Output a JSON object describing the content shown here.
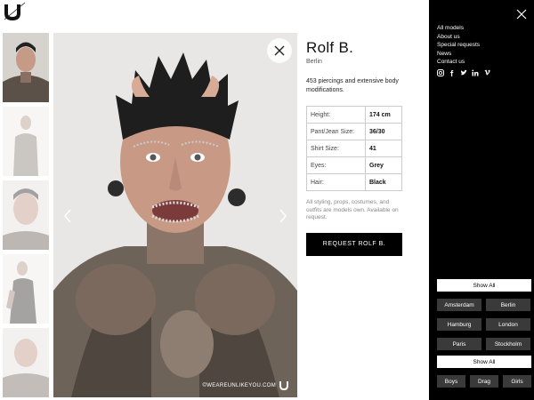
{
  "brand": {
    "logo_letter": "U"
  },
  "model": {
    "name": "Rolf B.",
    "city": "Berlin",
    "bio": "453 piercings and extensive body modifications.",
    "specs": [
      {
        "key": "Height:",
        "value": "174 cm"
      },
      {
        "key": "Pant/Jean Size:",
        "value": "36/30"
      },
      {
        "key": "Shirt Size:",
        "value": "41"
      },
      {
        "key": "Eyes:",
        "value": "Grey"
      },
      {
        "key": "Hair:",
        "value": "Black"
      }
    ],
    "note": "All styling, props, costumes, and outfits are models own. Available on request.",
    "request_label": "REQUEST ROLF B."
  },
  "photo": {
    "watermark": "©WEAREUNLIKEYOU.COM"
  },
  "menu": {
    "links": [
      "All models",
      "About us",
      "Special requests",
      "News",
      "Contact us"
    ],
    "socials": [
      "instagram-icon",
      "facebook-icon",
      "twitter-icon",
      "linkedin-icon",
      "vimeo-icon"
    ],
    "cities": {
      "show_all": "Show All",
      "items": [
        "Amsterdam",
        "Berlin",
        "Hamburg",
        "London",
        "Paris",
        "Stockholm"
      ]
    },
    "genders": {
      "show_all": "Show All",
      "items": [
        "Boys",
        "Drag",
        "Girls"
      ]
    }
  },
  "colors": {
    "menu_bg": "#000000",
    "chip_bg": "#3a3a3a",
    "accent": "#000000"
  }
}
